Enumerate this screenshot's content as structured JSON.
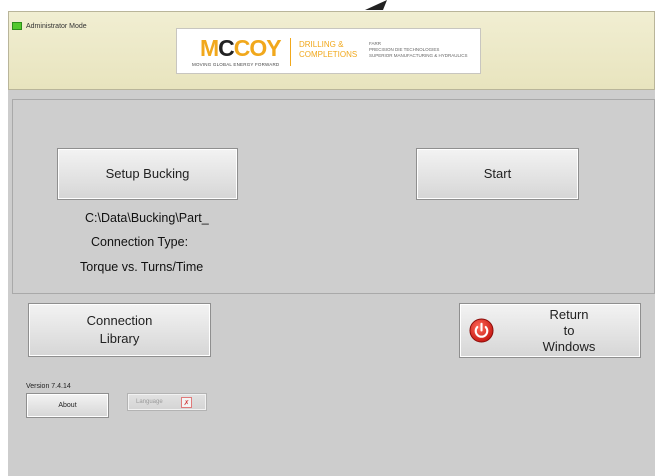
{
  "header": {
    "admin_mode_label": "Administrator Mode",
    "logo": {
      "wordmark_a": "M",
      "wordmark_b": "C",
      "wordmark_c": "COY",
      "tagline": "MOVING GLOBAL ENERGY FORWARD",
      "division_line1": "DRILLING &",
      "division_line2": "COMPLETIONS",
      "right_line1": "FARR",
      "right_line2": "PRECISION DIE TECHNOLOGIES",
      "right_line3": "SUPERIOR MANUFACTURING & HYDRAULICS"
    }
  },
  "main": {
    "setup_button": "Setup Bucking",
    "start_button": "Start",
    "file_path": "C:\\Data\\Bucking\\Part_",
    "connection_type_label": "Connection Type:",
    "mode_label": "Torque vs. Turns/Time"
  },
  "bottom": {
    "connection_library_line1": "Connection",
    "connection_library_line2": "Library",
    "return_line1": "Return",
    "return_line2": "to",
    "return_line3": "Windows",
    "version": "Version 7.4.14",
    "about_button": "About",
    "language_button": "Language"
  },
  "colors": {
    "header_bg": "#ece8c8",
    "panel_bg": "#cecece",
    "admin_led": "#54c82e",
    "logo_accent": "#f1a81c",
    "power_icon": "#e02020"
  },
  "icons": {
    "admin": "green-led-icon",
    "return": "power-icon",
    "language": "flag-icon"
  }
}
